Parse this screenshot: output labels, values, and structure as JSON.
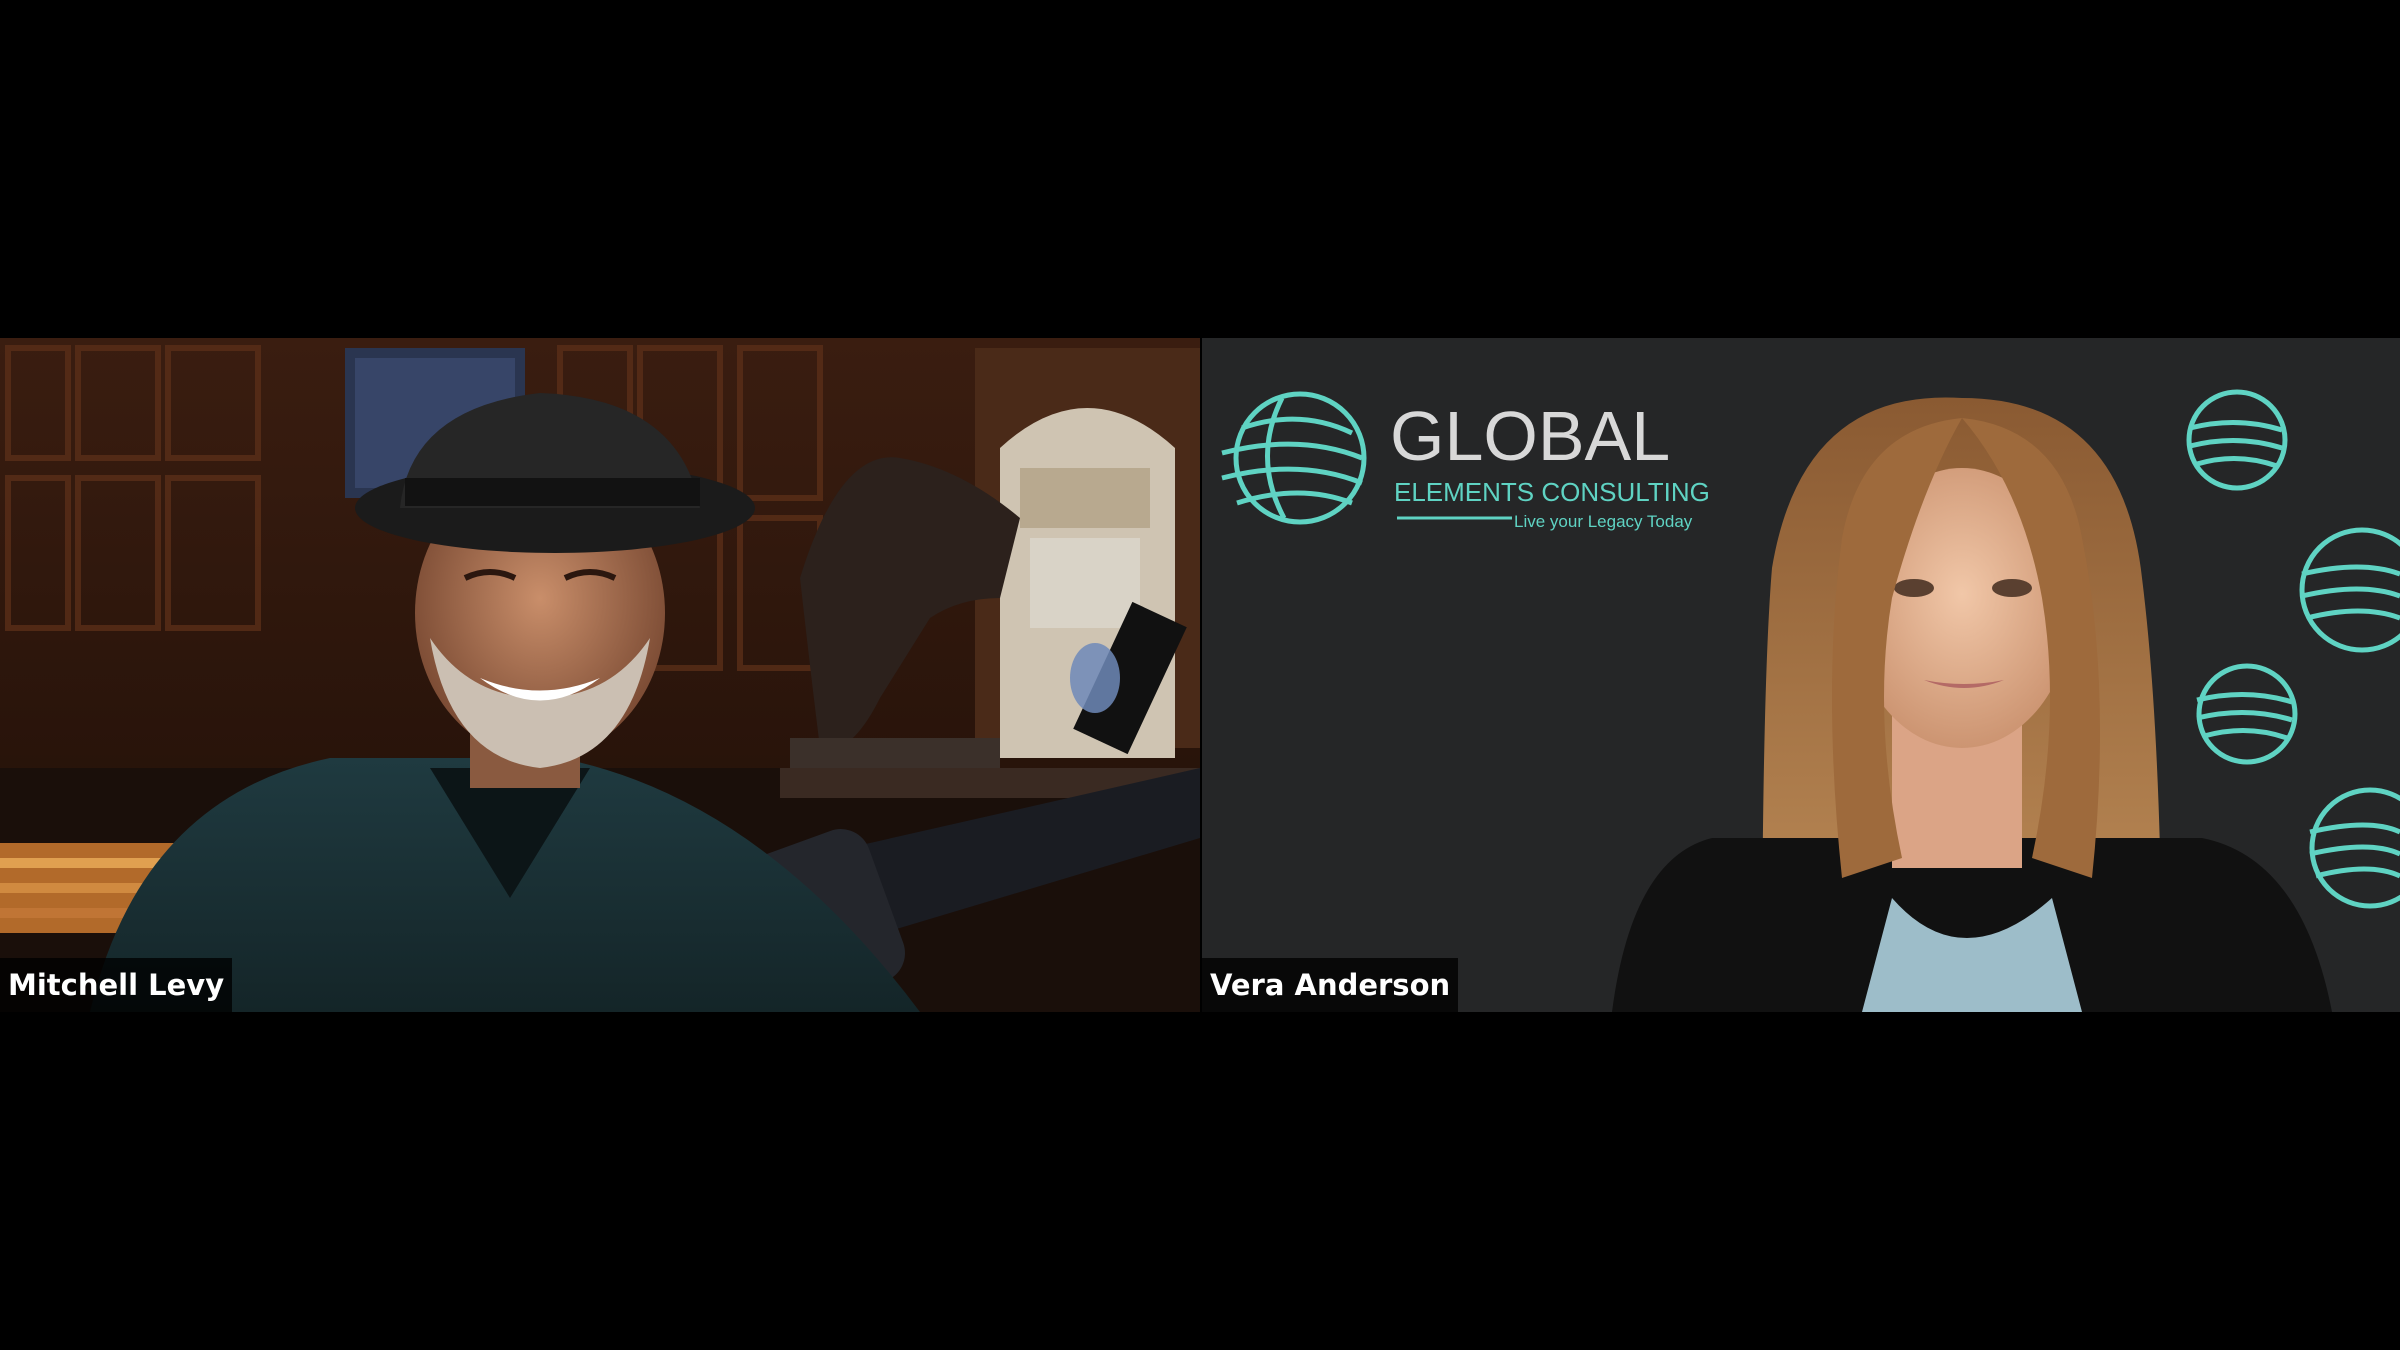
{
  "participants": [
    {
      "name": "Mitchell Levy",
      "muted": false
    },
    {
      "name": "Vera Anderson",
      "muted": false
    }
  ],
  "branding": {
    "logo_title": "GLOBAL",
    "logo_subtitle": "ELEMENTS CONSULTING",
    "logo_tagline": "Live your Legacy Today"
  },
  "colors": {
    "background": "#000000",
    "teal_accent": "#5fd3c3",
    "name_tag_bg": "#111111",
    "name_tag_text": "#ffffff"
  }
}
